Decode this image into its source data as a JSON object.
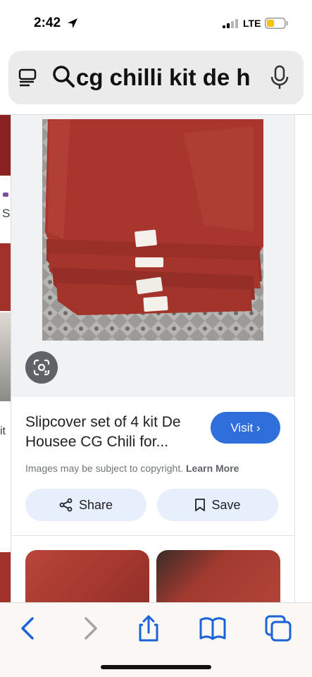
{
  "status_bar": {
    "time": "2:42",
    "network": "LTE"
  },
  "url_bar": {
    "query": "cg chilli kit de h"
  },
  "side_strip": {
    "letter_s": "S",
    "text_it": "it"
  },
  "result": {
    "title": "Slipcover set of 4 kit De Housee CG Chili for...",
    "visit_label": "Visit",
    "copyright_text": "Images may be subject to copyright.",
    "learn_more": "Learn More",
    "share_label": "Share",
    "save_label": "Save"
  },
  "colors": {
    "accent": "#2f6fdc",
    "pill_bg": "#e8effc",
    "product_red": "#a8362e"
  },
  "icons": [
    "location-arrow-icon",
    "signal-icon",
    "battery-icon",
    "reader-icon",
    "search-icon",
    "mic-icon",
    "lens-icon",
    "share-icon",
    "bookmark-icon",
    "back-icon",
    "forward-icon",
    "share-sheet-icon",
    "bookmarks-icon",
    "tabs-icon"
  ]
}
